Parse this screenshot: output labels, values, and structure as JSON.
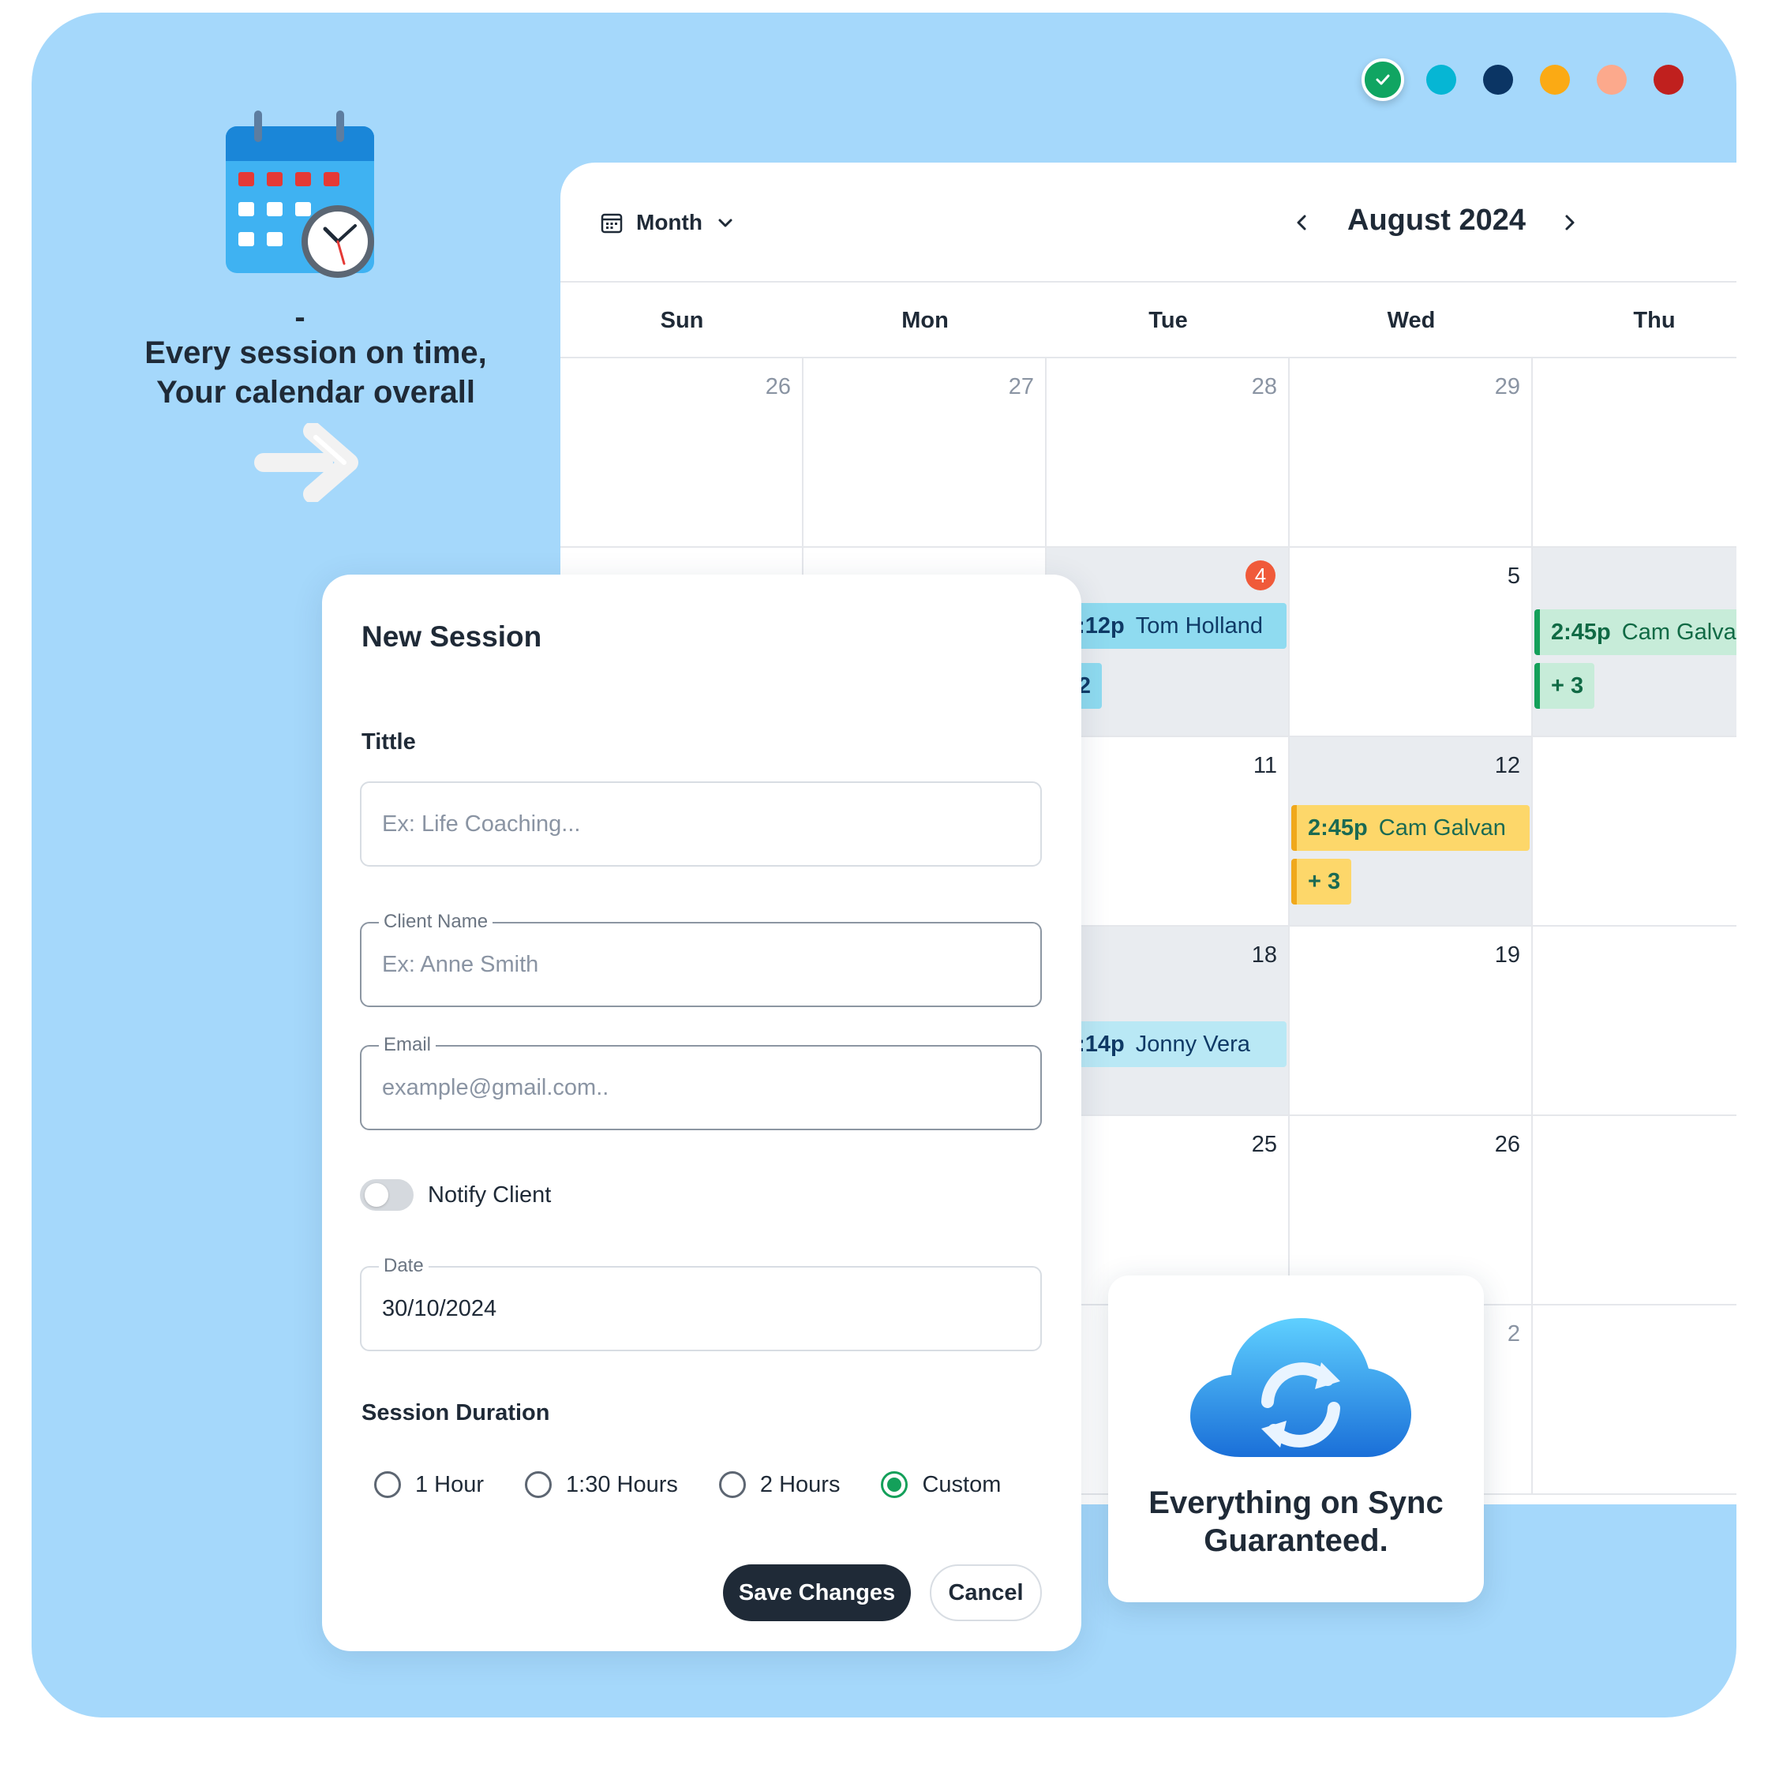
{
  "colors": {
    "background": "#a5d8fb",
    "swatches": [
      "#10a562",
      "#06b6d4",
      "#0b3564",
      "#fbaa14",
      "#fca98c",
      "#c0201e"
    ],
    "today_badge": "#f05a3a",
    "primary_button": "#1f2a37"
  },
  "promo": {
    "calendar_icon": "calendar-clock-icon",
    "dash": "-",
    "line1": "Every session on time,",
    "line2": "Your calendar overall",
    "arrow_icon": "arrow-right-icon"
  },
  "calendar": {
    "view_icon": "calendar-icon",
    "view_label": "Month",
    "month_title": "August 2024",
    "weekdays": [
      "Sun",
      "Mon",
      "Tue",
      "Wed",
      "Thu"
    ],
    "weeks": [
      {
        "days": [
          "26",
          "27",
          "28",
          "29",
          ""
        ]
      },
      {
        "days": [
          "",
          "",
          "4",
          "5",
          ""
        ]
      },
      {
        "days": [
          "",
          "",
          "11",
          "12",
          ""
        ]
      },
      {
        "days": [
          "",
          "",
          "18",
          "19",
          ""
        ]
      },
      {
        "days": [
          "",
          "",
          "25",
          "26",
          ""
        ]
      },
      {
        "days": [
          "",
          "",
          "",
          "2",
          ""
        ]
      }
    ],
    "events": {
      "tue4": {
        "time": "2:12p",
        "name": "Tom Holland",
        "more": "+2"
      },
      "thu1": {
        "time": "2:45p",
        "name": "Cam Galvan",
        "more": "+ 3"
      },
      "wed12": {
        "time": "2:45p",
        "name": "Cam Galvan",
        "more": "+ 3"
      },
      "tue18": {
        "time": "4:14p",
        "name": "Jonny Vera"
      }
    }
  },
  "dialog": {
    "title": "New Session",
    "title_field": {
      "label": "Tittle",
      "placeholder": "Ex: Life Coaching..."
    },
    "client_field": {
      "legend": "Client Name",
      "placeholder": "Ex: Anne Smith"
    },
    "email_field": {
      "legend": "Email",
      "placeholder": "example@gmail.com.."
    },
    "notify": {
      "label": "Notify Client",
      "on": false
    },
    "date_field": {
      "legend": "Date",
      "value": "30/10/2024"
    },
    "duration": {
      "label": "Session Duration",
      "options": [
        "1 Hour",
        "1:30 Hours",
        "2 Hours",
        "Custom"
      ],
      "selected": "Custom"
    },
    "save_label": "Save Changes",
    "cancel_label": "Cancel"
  },
  "sync": {
    "icon": "cloud-sync-icon",
    "line1": "Everything on Sync",
    "line2": "Guaranteed."
  }
}
